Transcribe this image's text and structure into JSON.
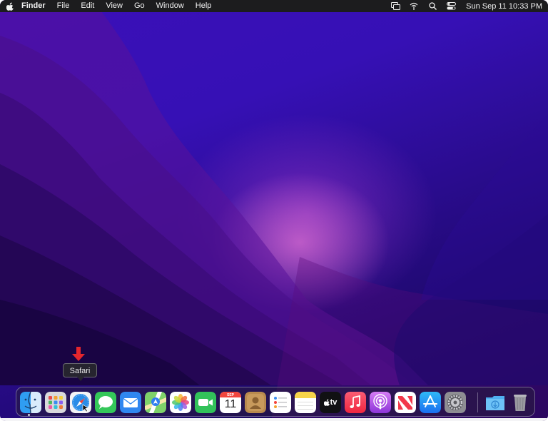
{
  "menubar": {
    "app_name": "Finder",
    "menus": [
      "File",
      "Edit",
      "View",
      "Go",
      "Window",
      "Help"
    ],
    "clock": "Sun Sep 11  10:33 PM",
    "status_icons": [
      "screen-mirroring-icon",
      "wifi-icon",
      "search-icon",
      "control-center-icon"
    ]
  },
  "tooltip": {
    "label": "Safari"
  },
  "dock": {
    "calendar": {
      "month": "SEP",
      "day": "11"
    },
    "tv_label": "tv",
    "apps": [
      "finder",
      "launchpad",
      "safari",
      "messages",
      "mail",
      "maps",
      "photos",
      "facetime",
      "calendar",
      "contacts",
      "reminders",
      "notes",
      "tv",
      "music",
      "podcasts",
      "news",
      "app-store",
      "system-preferences",
      "downloads",
      "trash"
    ]
  },
  "colors": {
    "menubar_bg": "#1c1c1e",
    "wallpaper_top": "#3b0fb8",
    "wallpaper_glow": "#d86ed2",
    "arrow": "#e5262d"
  }
}
